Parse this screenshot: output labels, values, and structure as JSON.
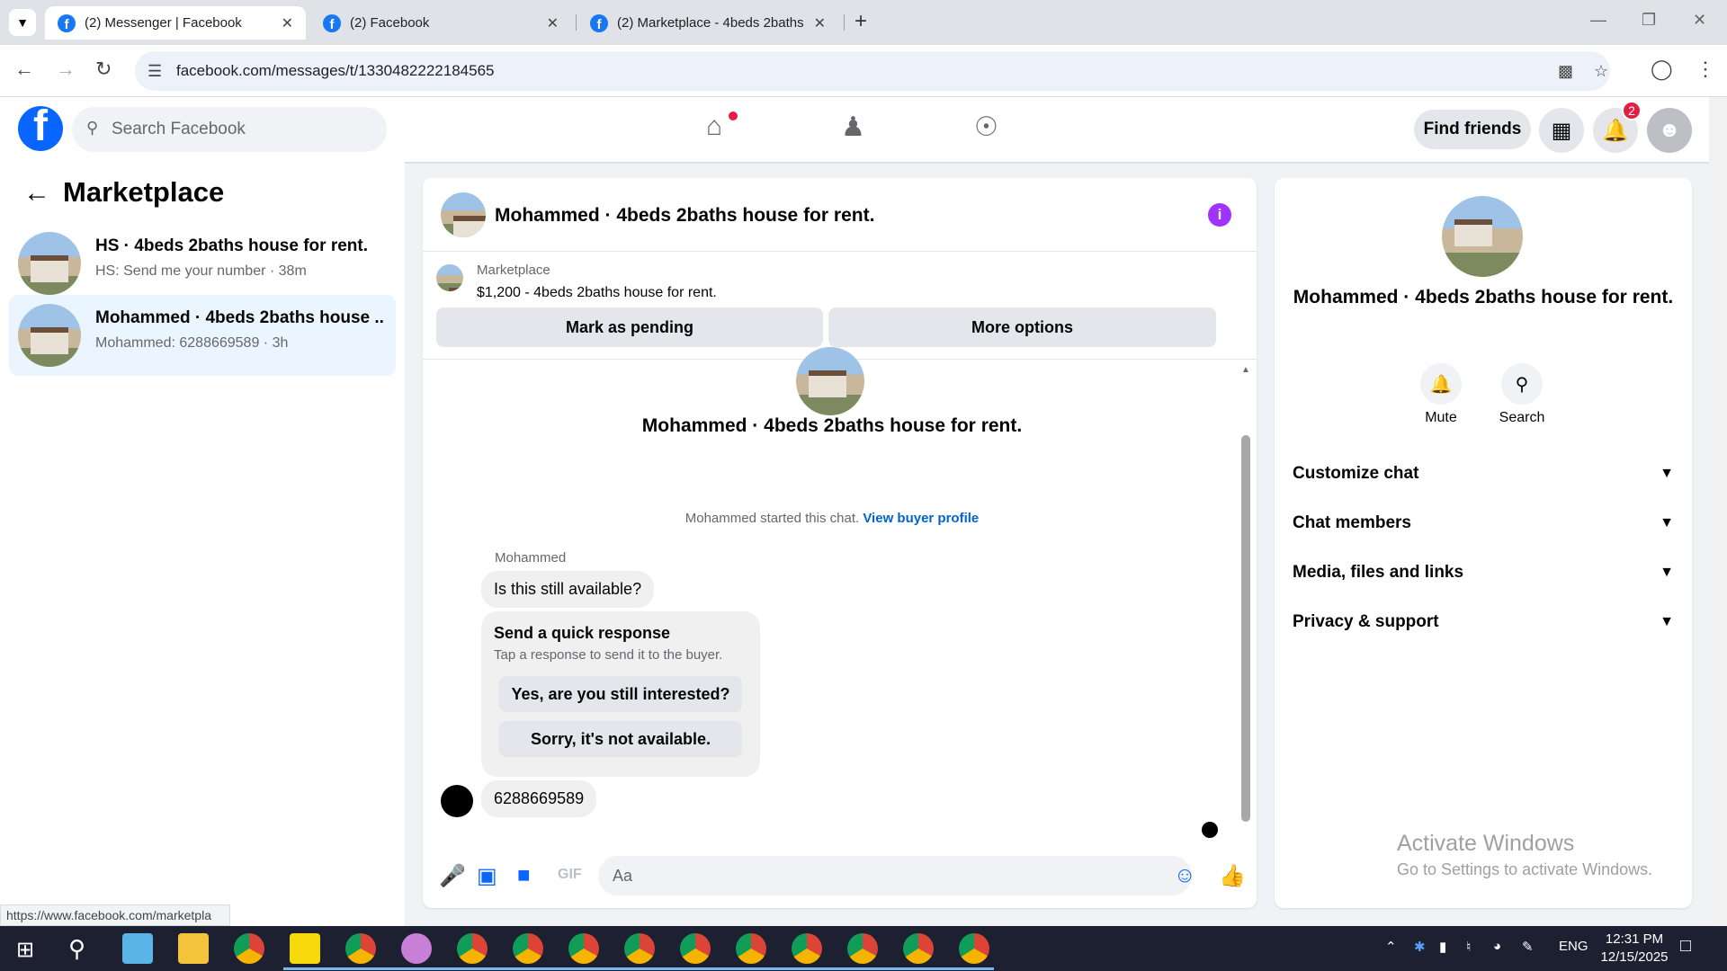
{
  "browser": {
    "tabs": [
      {
        "title": "(2) Messenger | Facebook"
      },
      {
        "title": "(2) Facebook"
      },
      {
        "title": "(2) Marketplace - 4beds 2baths"
      }
    ],
    "url": "facebook.com/messages/t/1330482222184565",
    "status_url": "https://www.facebook.com/marketpla"
  },
  "header": {
    "search_placeholder": "Search Facebook",
    "find_friends": "Find friends",
    "notification_count": "2"
  },
  "left_panel": {
    "title": "Marketplace",
    "conversations": [
      {
        "title": "HS · 4beds 2baths house for rent.",
        "subtitle": "HS: Send me your number · 38m"
      },
      {
        "title": "Mohammed · 4beds 2baths house ...",
        "subtitle": "Mohammed: 6288669589 · 3h"
      }
    ]
  },
  "chat": {
    "title": "Mohammed · 4beds 2baths house for rent.",
    "marketplace_label": "Marketplace",
    "listing": "$1,200 - 4beds 2baths house for rent.",
    "mark_pending": "Mark as pending",
    "more_options": "More options",
    "thread_title": "Mohammed · 4beds 2baths house for rent.",
    "started_text": "Mohammed started this chat.",
    "view_buyer": "View buyer profile",
    "sender": "Mohammed",
    "msg1": "Is this still available?",
    "quick_title": "Send a quick response",
    "quick_sub": "Tap a response to send it to the buyer.",
    "quick_1": "Yes, are you still interested?",
    "quick_2": "Sorry, it's not available.",
    "msg2": "6288669589",
    "composer_placeholder": "Aa"
  },
  "right_panel": {
    "title": "Mohammed · 4beds 2baths house for rent.",
    "mute": "Mute",
    "search": "Search",
    "rows": [
      "Customize chat",
      "Chat members",
      "Media, files and links",
      "Privacy & support"
    ]
  },
  "watermark": {
    "line1": "Activate Windows",
    "line2": "Go to Settings to activate Windows."
  },
  "taskbar": {
    "lang": "ENG",
    "time": "12:31 PM",
    "date": "12/15/2025"
  }
}
